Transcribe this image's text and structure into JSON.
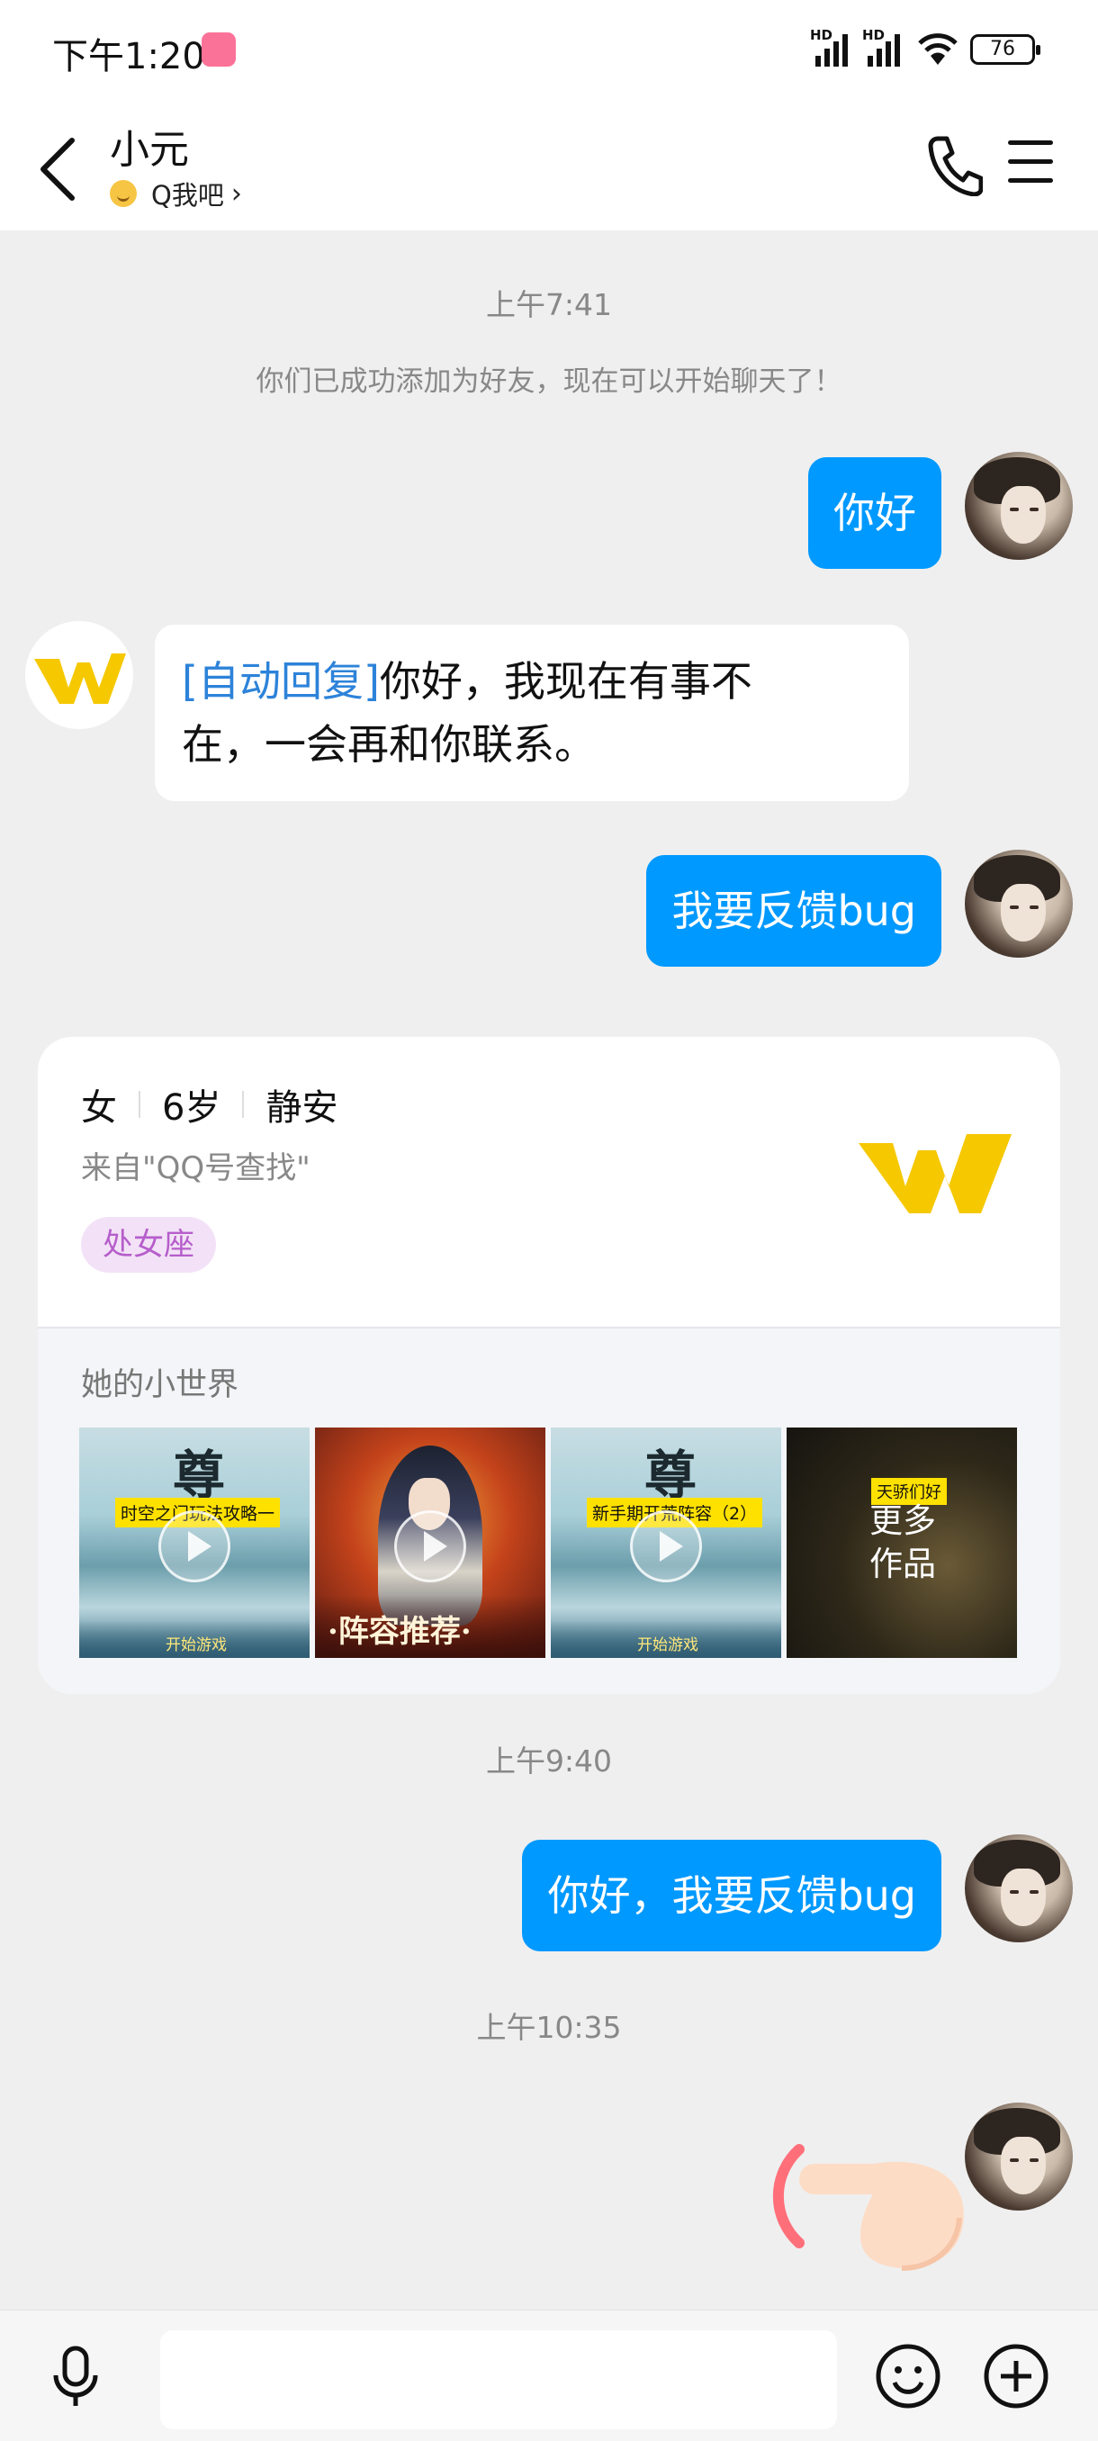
{
  "status_bar": {
    "time": "下午1:20",
    "network_1": "HD",
    "network_2": "HD",
    "battery": "76"
  },
  "header": {
    "contact_name": "小元",
    "subtitle": "Q我吧"
  },
  "chat": {
    "timestamp_1": "上午7:41",
    "system_message": "你们已成功添加为好友，现在可以开始聊天了！",
    "msg_1": "你好",
    "auto_reply_tag": "[自动回复]",
    "auto_reply_text_line1": "你好，我现在有事不",
    "auto_reply_text_line2": "在，一会再和你联系。",
    "msg_2": "我要反馈bug",
    "timestamp_2": "上午9:40",
    "msg_3": "你好，我要反馈bug",
    "timestamp_3": "上午10:35"
  },
  "profile_card": {
    "gender": "女",
    "age": "6岁",
    "location": "静安",
    "source": "来自\"QQ号查找\"",
    "zodiac_tag": "处女座",
    "section_title": "她的小世界",
    "thumbnails": [
      {
        "brush_title": "尊",
        "caption": "时空之门玩法攻略一",
        "bottom_text": "开始游戏"
      },
      {
        "caption": "·阵容推荐·"
      },
      {
        "brush_title": "尊",
        "caption": "新手期开荒阵容（2）",
        "bottom_text": "开始游戏"
      },
      {
        "label": "天骄们好",
        "more_text": "更多作品"
      }
    ]
  },
  "colors": {
    "accent_blue": "#0099ff",
    "auto_reply_blue": "#2d83d9",
    "tag_bg": "#f3e2f7",
    "tag_fg": "#b65ecb",
    "logo_yellow": "#f5c800"
  },
  "icons": [
    "back-arrow-icon",
    "phone-icon",
    "menu-icon",
    "mic-icon",
    "emoji-icon",
    "plus-icon",
    "play-icon",
    "pointing-hand-icon"
  ]
}
